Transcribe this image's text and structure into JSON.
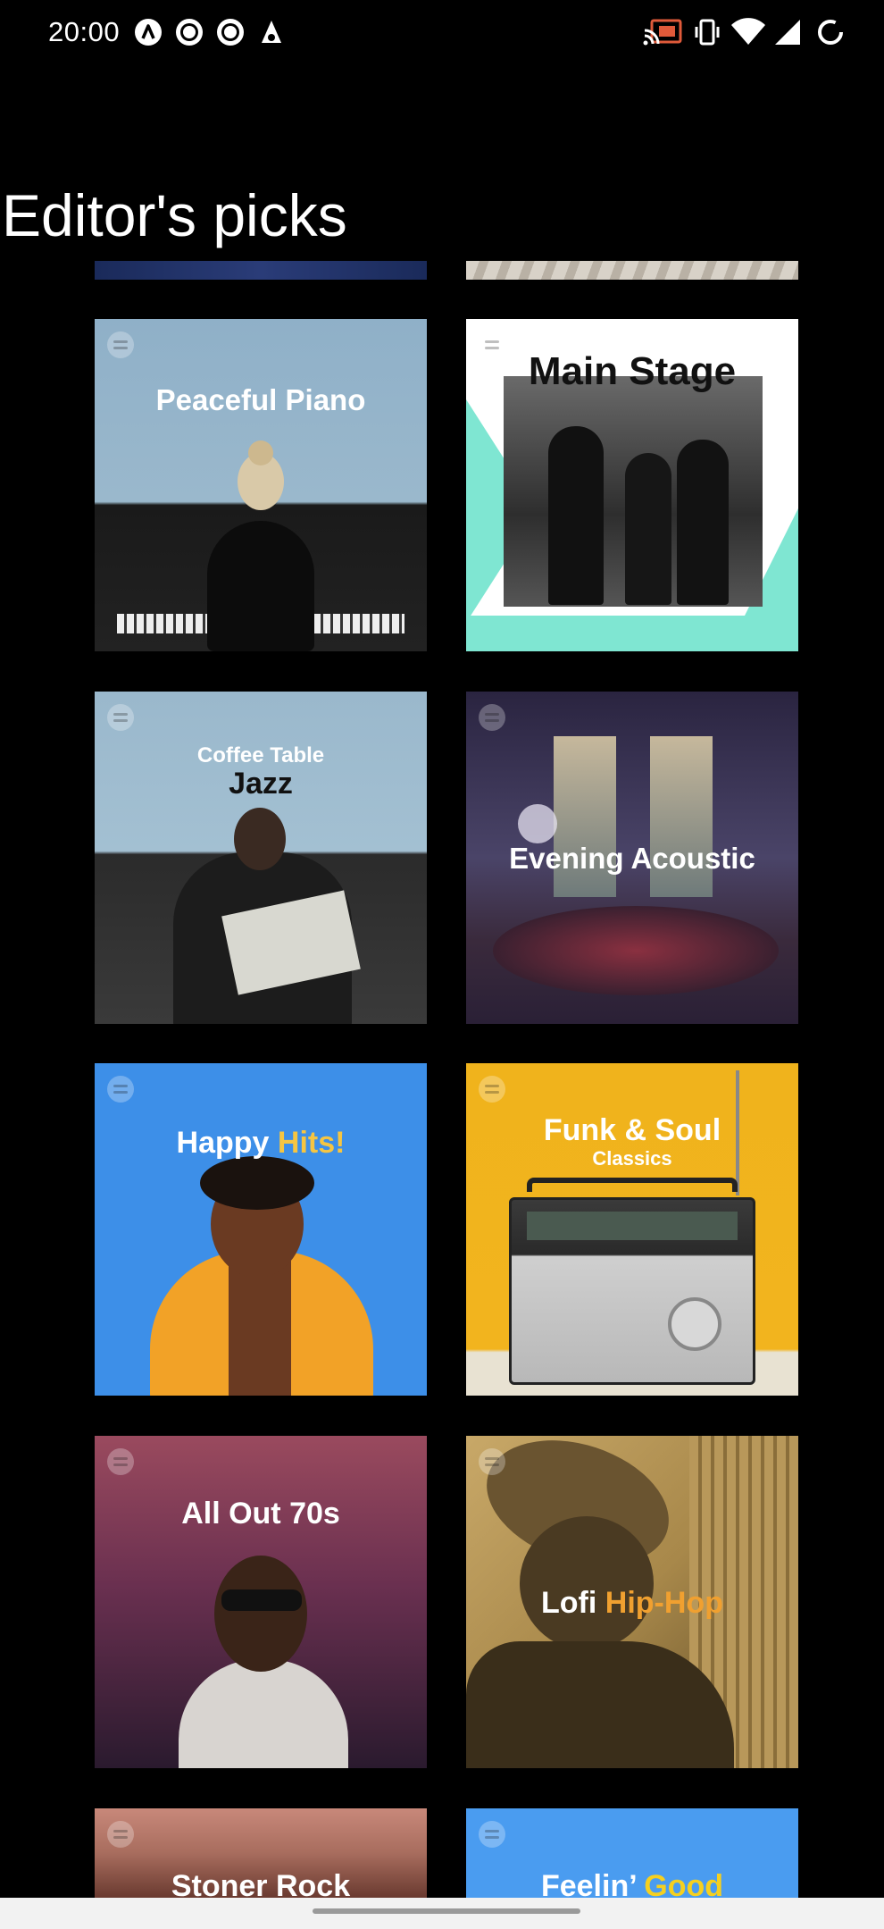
{
  "status_bar": {
    "time": "20:00",
    "left_icons": [
      "autofill-icon",
      "record-icon",
      "record-icon",
      "app-notification-icon"
    ],
    "right_icons": [
      "cast-icon",
      "vibrate-icon",
      "wifi-icon",
      "signal-icon",
      "battery-loading-icon"
    ]
  },
  "page": {
    "title": "Editor's picks"
  },
  "playlists": [
    {
      "title": "Peaceful Piano",
      "art_color": "#8fb0c8"
    },
    {
      "title": "Main Stage",
      "art_color": "#7fe6d2"
    },
    {
      "kicker": "Coffee Table",
      "title": "Jazz",
      "art_color": "#9ab8cc"
    },
    {
      "title": "Evening Acoustic",
      "art_color": "#3f3a5e"
    },
    {
      "title": "Happy",
      "highlight": "Hits!",
      "highlight_color": "#f5c542",
      "art_color": "#3d8fe8"
    },
    {
      "title": "Funk & Soul",
      "subtitle": "Classics",
      "art_color": "#f0b31c"
    },
    {
      "title": "All Out 70s",
      "art_color": "#7a3a55"
    },
    {
      "title": "Lofi",
      "highlight": "Hip-Hop",
      "highlight_color": "#f0a030",
      "art_color": "#a8884a"
    },
    {
      "title": "Stoner Rock",
      "art_color": "#a86d5e"
    },
    {
      "title": "Feelin’",
      "highlight": "Good",
      "highlight_color": "#f5d020",
      "art_color": "#4a9cf0"
    }
  ]
}
